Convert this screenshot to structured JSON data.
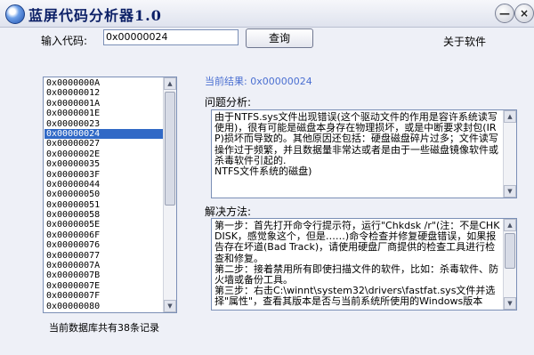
{
  "window": {
    "title": "蓝屏代码分析器1.0",
    "min_label": "—",
    "close_label": "×"
  },
  "search": {
    "label": "输入代码:",
    "value": "0x00000024",
    "query_button": "查询",
    "about_link": "关于软件"
  },
  "codes": {
    "selected_index": 10,
    "items": [
      "0x0000000A",
      "0x00000012",
      "0x0000001A",
      "0x0000001E",
      "0x00000023",
      "0x00000024",
      "0x00000027",
      "0x0000002E",
      "0x00000035",
      "0x0000003F",
      "0x00000044",
      "0x00000050",
      "0x00000051",
      "0x00000058",
      "0x0000005E",
      "0x0000006F",
      "0x00000076",
      "0x00000077",
      "0x0000007A",
      "0x0000007B",
      "0x0000007E",
      "0x0000007F",
      "0x00000080"
    ]
  },
  "result": {
    "current_label": "当前结果: 0x00000024",
    "analysis_heading": "问题分析:",
    "analysis_text": "由于NTFS.sys文件出现错误(这个驱动文件的作用是容许系统读写使用)，很有可能是磁盘本身存在物理损坏，或是中断要求封包(IRP)损坏而导致的。其他原因还包括：硬盘磁盘碎片过多；文件读写操作过于频繁，并且数据量非常达或者是由于一些磁盘镜像软件或杀毒软件引起的.\nNTFS文件系统的磁盘)",
    "solution_heading": "解决方法:",
    "solution_text": "第一步：首先打开命令行提示符，运行\"Chkdsk /r\"(注：不是CHKDISK，感觉象这个，但是……)命令检查并修复硬盘错误，如果报告存在坏道(Bad Track)，请使用硬盘厂商提供的检查工具进行检查和修复。\n第二步：接着禁用所有即使扫描文件的软件，比如：杀毒软件、防火墙或备份工具。\n第三步：右击C:\\winnt\\system32\\drivers\\fastfat.sys文件并选择\"属性\"，查看其版本是否与当前系统所使用的Windows版本"
  },
  "footer": {
    "record_count_text": "当前数据库共有38条记录"
  }
}
